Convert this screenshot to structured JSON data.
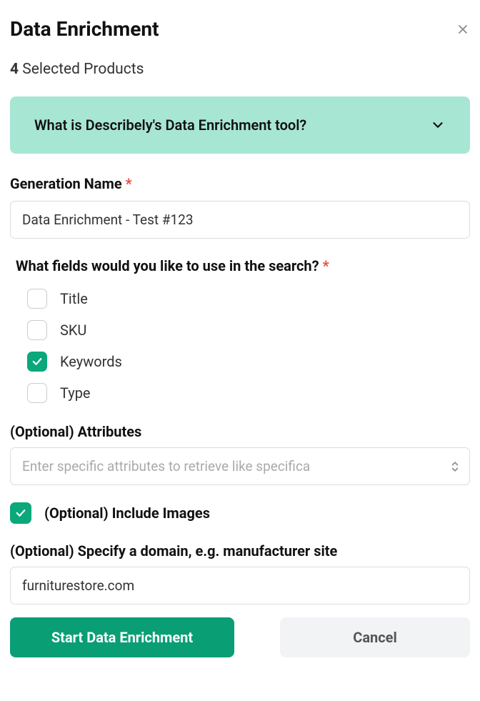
{
  "title": "Data Enrichment",
  "selected_count": "4",
  "selected_label": "Selected Products",
  "info_banner": "What is Describely's Data Enrichment tool?",
  "generation_name": {
    "label": "Generation Name",
    "value": "Data Enrichment - Test #123"
  },
  "search_fields": {
    "label": "What fields would you like to use in the search?",
    "options": [
      {
        "label": "Title",
        "checked": false
      },
      {
        "label": "SKU",
        "checked": false
      },
      {
        "label": "Keywords",
        "checked": true
      },
      {
        "label": "Type",
        "checked": false
      }
    ]
  },
  "attributes": {
    "label": "(Optional) Attributes",
    "placeholder": "Enter specific attributes to retrieve like specifica"
  },
  "include_images": {
    "label": "(Optional) Include Images",
    "checked": true
  },
  "domain": {
    "label": "(Optional) Specify a domain, e.g. manufacturer site",
    "value": "furniturestore.com"
  },
  "buttons": {
    "start": "Start Data Enrichment",
    "cancel": "Cancel"
  },
  "required_mark": "*"
}
